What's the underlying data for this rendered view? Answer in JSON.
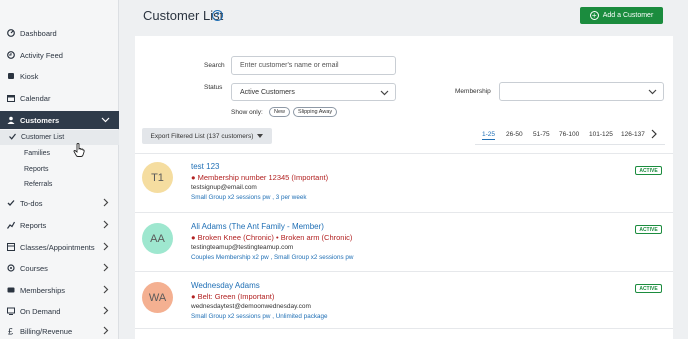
{
  "sidebar": {
    "items": [
      {
        "label": "Dashboard",
        "icon": "dashboard-icon"
      },
      {
        "label": "Activity Feed",
        "icon": "activity-icon"
      },
      {
        "label": "Kiosk",
        "icon": "kiosk-icon"
      },
      {
        "label": "Calendar",
        "icon": "calendar-icon"
      },
      {
        "label": "Customers",
        "icon": "customers-icon"
      },
      {
        "label": "To-dos",
        "icon": "todo-icon"
      },
      {
        "label": "Reports",
        "icon": "reports-icon"
      },
      {
        "label": "Classes/Appointments",
        "icon": "classes-icon"
      },
      {
        "label": "Courses",
        "icon": "courses-icon"
      },
      {
        "label": "Memberships",
        "icon": "memberships-icon"
      },
      {
        "label": "On Demand",
        "icon": "on-demand-icon"
      },
      {
        "label": "Billing/Revenue",
        "icon": "billing-icon"
      }
    ],
    "customers_sub": [
      "Customer List",
      "Families",
      "Reports",
      "Referrals"
    ]
  },
  "header": {
    "title": "Customer List",
    "help": "?",
    "add_button": "Add a Customer"
  },
  "filters": {
    "search_label": "Search",
    "search_placeholder": "Enter customer's name or email",
    "status_label": "Status",
    "status_value": "Active Customers",
    "membership_label": "Membership",
    "membership_value": "",
    "show_only_label": "Show only:",
    "pills": [
      "New",
      "Slipping Away"
    ]
  },
  "export_button": "Export Filtered List (137 customers)",
  "pagination": [
    "1-25",
    "26-50",
    "51-75",
    "76-100",
    "101-125",
    "126-137"
  ],
  "customers": [
    {
      "initials": "T1",
      "name": "test 123",
      "family": "",
      "alert": "Membership number 12345 (Important)",
      "email": "testsignup@email.com",
      "memberships": "Small Group x2 sessions pw , 3 per week",
      "status": "ACTIVE",
      "avatar_color": "#f5dda0"
    },
    {
      "initials": "AA",
      "name": "Ali Adams",
      "family": "(The Ant Family - Member)",
      "alert": "Broken Knee (Chronic) • Broken arm (Chronic)",
      "email": "testingteamup@testingteamup.com",
      "memberships": "Couples Membership x2 pw , Small Group x2 sessions pw",
      "status": "ACTIVE",
      "avatar_color": "#9ee7cf"
    },
    {
      "initials": "WA",
      "name": "Wednesday Adams",
      "family": "",
      "alert": "Belt: Green (Important)",
      "email": "wednesdaytest@demoonwednesday.com",
      "memberships": "Small Group x2 sessions pw , Unlimited package",
      "status": "ACTIVE",
      "avatar_color": "#f4b091"
    }
  ],
  "colors": {
    "brand_green": "#1b8c3e",
    "link_blue": "#1f6fb5",
    "sidebar_active": "#2f3b4a",
    "alert_red": "#b22222"
  }
}
